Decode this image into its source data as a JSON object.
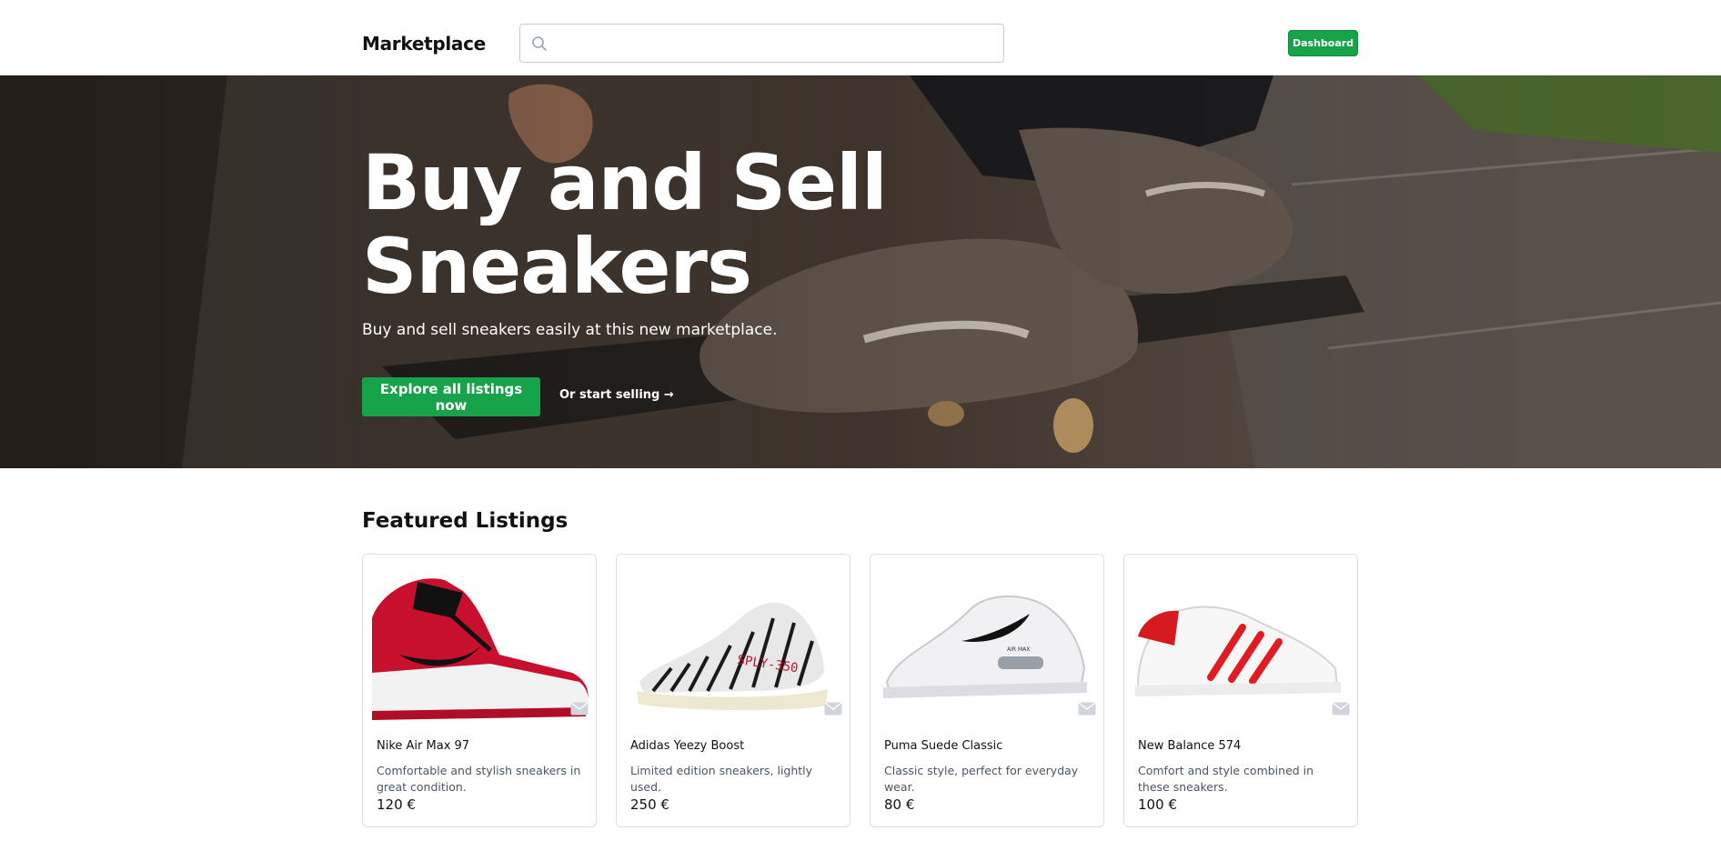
{
  "header": {
    "brand": "Marketplace",
    "search_placeholder": "",
    "dashboard_label": "Dashboard"
  },
  "hero": {
    "title": "Buy and Sell Sneakers",
    "subtitle": "Buy and sell sneakers easily at this new marketplace.",
    "cta_primary": "Explore all listings now",
    "cta_secondary": "Or start selling →"
  },
  "featured": {
    "title": "Featured Listings",
    "listings": [
      {
        "name": "Nike Air Max 97",
        "description": "Comfortable and stylish sneakers in great condition.",
        "price": "120 €",
        "image_icon": "red-high-top-sneaker-image"
      },
      {
        "name": "Adidas Yeezy Boost",
        "description": "Limited edition sneakers, lightly used.",
        "price": "250 €",
        "image_icon": "zebra-knit-sneaker-image"
      },
      {
        "name": "Puma Suede Classic",
        "description": "Classic style, perfect for everyday wear.",
        "price": "80 €",
        "image_icon": "white-running-sneaker-image"
      },
      {
        "name": "New Balance 574",
        "description": "Comfort and style combined in these sneakers.",
        "price": "100 €",
        "image_icon": "white-red-striped-sneaker-image"
      }
    ]
  },
  "colors": {
    "accent": "#16a34a",
    "text": "#111111",
    "muted": "#4b5563"
  }
}
